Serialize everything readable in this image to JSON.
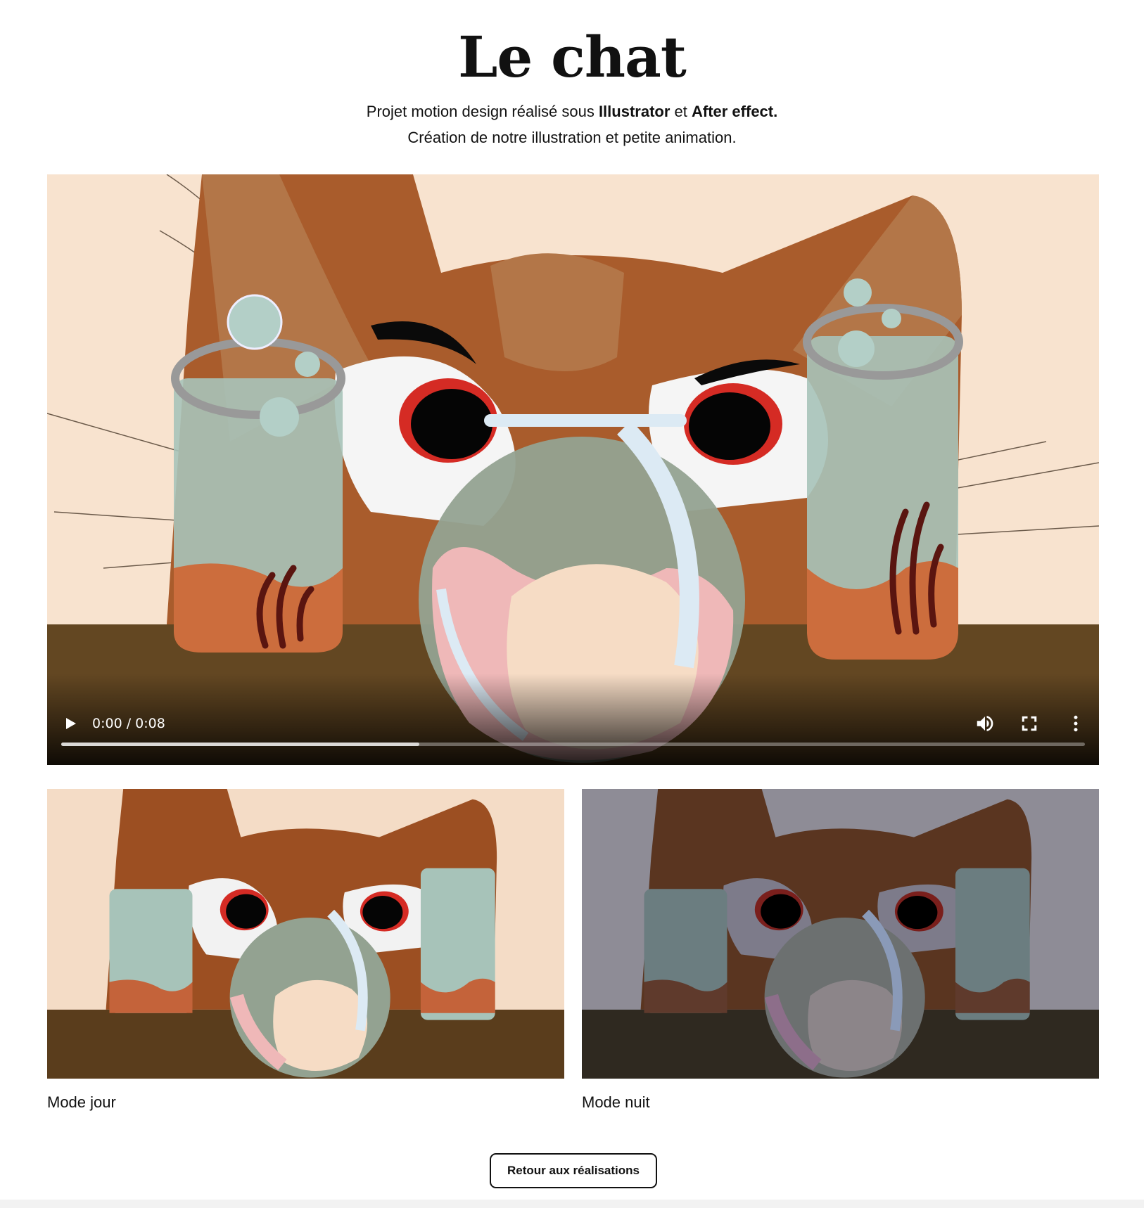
{
  "page": {
    "title": "Le chat",
    "intro_line1_a": "Projet motion design réalisé sous ",
    "intro_line1_b": "Illustrator",
    "intro_line1_c": " et ",
    "intro_line1_d": "After effect.",
    "intro_line2": "Création de notre illustration et petite animation."
  },
  "video": {
    "time_display": "0:00 / 0:08",
    "progress_fraction": 0.35,
    "icons": [
      "play-icon",
      "volume-icon",
      "fullscreen-icon",
      "more-options-icon"
    ]
  },
  "gallery": [
    {
      "caption": "Mode jour"
    },
    {
      "caption": "Mode nuit"
    }
  ],
  "actions": {
    "back_label": "Retour aux réalisations"
  },
  "colors": {
    "background": "#ffffff",
    "scene_wall": "#f8e3cf",
    "cat_fur": "#a95c2c",
    "table": "#634722"
  }
}
